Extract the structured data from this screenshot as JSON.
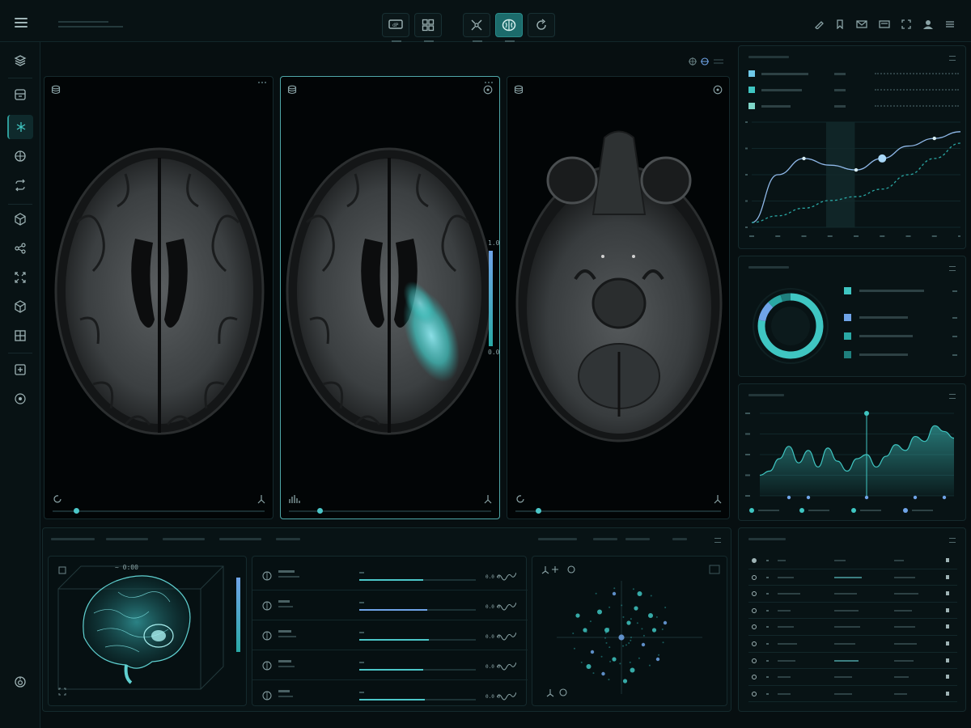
{
  "app": {
    "name": "neuro-imaging-dashboard"
  },
  "icons": {
    "menu": "hamburger-icon",
    "tools": [
      "monitor-icon",
      "grid-layout-icon",
      "crosshair-icon",
      "brain-icon",
      "refresh-icon"
    ],
    "top_right": [
      "pencil-icon",
      "bookmark-icon",
      "mail-icon",
      "inbox-icon",
      "fullscreen-icon",
      "user-icon",
      "more-icon"
    ],
    "sidebar": [
      "layers-icon",
      "storage-icon",
      "network-icon",
      "globe-icon",
      "flip-icon",
      "cube-icon",
      "share-icon",
      "expand-icon",
      "cube-outline-icon",
      "layout-icon",
      "add-square-icon",
      "target-icon",
      "settings-icon"
    ]
  },
  "colors": {
    "accent": "#3fc6c2",
    "accent_blue": "#6fa4e8",
    "bg": "#070f11",
    "panel": "#081315"
  },
  "viewer": {
    "active_tool_index": 3,
    "active_panel_index": 1,
    "panels": [
      {
        "view": "axial-upper",
        "slider": 0.12,
        "overlay": false
      },
      {
        "view": "axial-upper",
        "slider": 0.15,
        "overlay": true
      },
      {
        "view": "axial-lower",
        "slider": 0.1,
        "overlay": false
      }
    ],
    "colorbar_min": "0.0",
    "colorbar_max": "1.0"
  },
  "mini_3d": {
    "labels": [
      "~ 0:00"
    ]
  },
  "metrics_list": {
    "rows": [
      {
        "value": "0.0 0",
        "progress": 0.55
      },
      {
        "value": "0.0 0",
        "progress": 0.58
      },
      {
        "value": "0.0 0",
        "progress": 0.6
      },
      {
        "value": "0.0 0",
        "progress": 0.55
      },
      {
        "value": "0.0 0",
        "progress": 0.56
      }
    ]
  },
  "chart_data": [
    {
      "type": "line",
      "title": "",
      "x": [
        0,
        1,
        2,
        3,
        4,
        5,
        6,
        7,
        8
      ],
      "series": [
        {
          "values": [
            0.05,
            0.55,
            0.72,
            0.65,
            0.6,
            0.72,
            0.85,
            0.93,
            1.0
          ]
        },
        {
          "values": [
            0.05,
            0.12,
            0.2,
            0.28,
            0.32,
            0.4,
            0.55,
            0.72,
            0.88
          ]
        }
      ],
      "ylim": [
        0,
        1.1
      ],
      "grid": true
    },
    {
      "type": "pie",
      "title": "",
      "values": [
        78,
        10,
        7,
        5
      ],
      "colors": [
        "#3fc6c2",
        "#6fa4e8",
        "#2aa8a5",
        "#1f7f7d"
      ]
    },
    {
      "type": "area",
      "title": "",
      "x": [
        0,
        1,
        2,
        3,
        4,
        5,
        6,
        7,
        8,
        9,
        10,
        11,
        12,
        13,
        14,
        15,
        16,
        17,
        18,
        19,
        20
      ],
      "values": [
        0.25,
        0.3,
        0.45,
        0.6,
        0.4,
        0.55,
        0.35,
        0.58,
        0.42,
        0.3,
        0.45,
        0.5,
        0.35,
        0.48,
        0.62,
        0.55,
        0.72,
        0.66,
        0.85,
        0.78,
        0.7
      ],
      "ylim": [
        0,
        1
      ],
      "marker_index": 11
    },
    {
      "type": "scatter",
      "title": "",
      "points": [
        [
          0,
          0
        ],
        [
          0.1,
          0.2
        ],
        [
          -0.2,
          0.1
        ],
        [
          0.3,
          -0.1
        ],
        [
          -0.1,
          -0.3
        ],
        [
          0.4,
          0.3
        ],
        [
          -0.4,
          -0.2
        ],
        [
          0.2,
          0.4
        ],
        [
          -0.3,
          0.35
        ],
        [
          0.5,
          -0.3
        ],
        [
          -0.5,
          0.1
        ],
        [
          0.15,
          -0.45
        ],
        [
          -0.25,
          -0.5
        ],
        [
          0.45,
          0.1
        ],
        [
          -0.45,
          -0.4
        ],
        [
          0.6,
          0.2
        ],
        [
          -0.6,
          0.3
        ],
        [
          0.25,
          0.6
        ],
        [
          -0.1,
          0.6
        ],
        [
          0.05,
          -0.6
        ]
      ]
    }
  ],
  "table": {
    "rows": 9
  }
}
